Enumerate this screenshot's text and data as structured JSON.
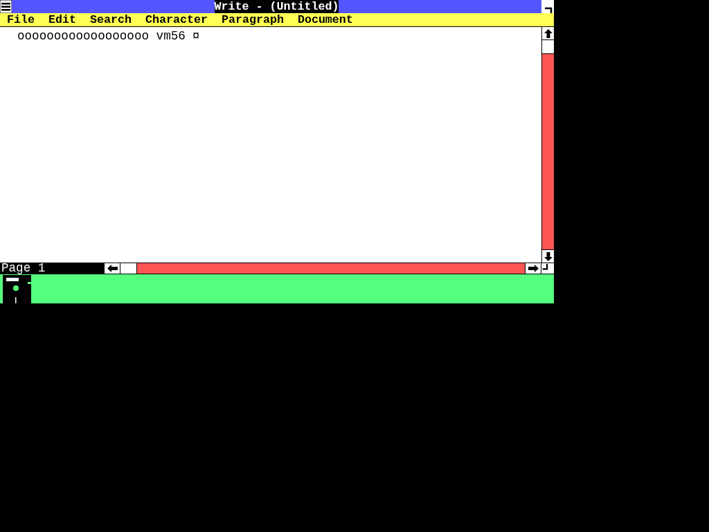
{
  "window": {
    "title": "Write - (Untitled)"
  },
  "menu": [
    {
      "label": "File"
    },
    {
      "label": "Edit"
    },
    {
      "label": "Search"
    },
    {
      "label": "Character"
    },
    {
      "label": "Paragraph"
    },
    {
      "label": "Document"
    }
  ],
  "document": {
    "text": "oooooooooooooooooo vm56",
    "end_mark": "¤"
  },
  "status_bar": {
    "page": "Page 1"
  }
}
